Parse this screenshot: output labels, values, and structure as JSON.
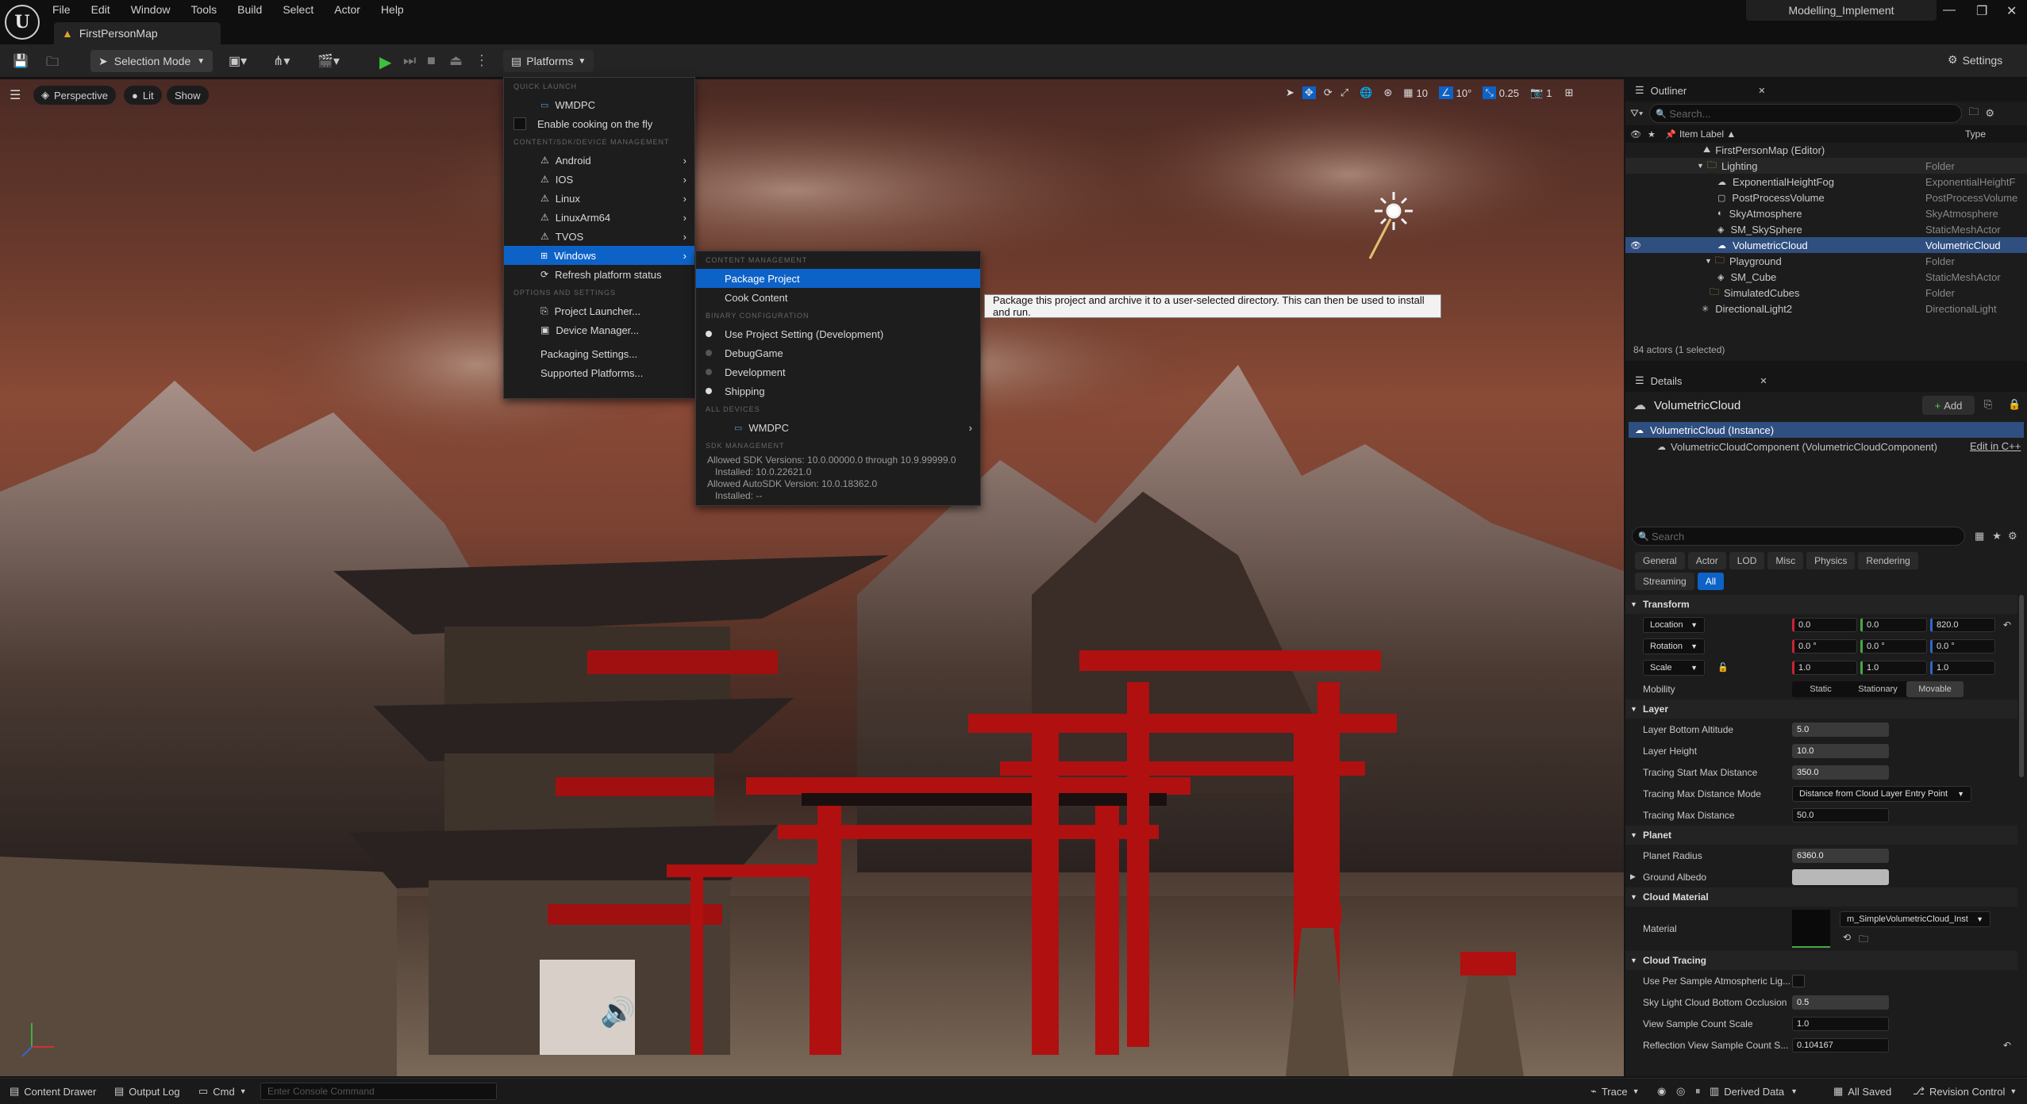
{
  "titlebar": {
    "logo": "U",
    "menu": [
      "File",
      "Edit",
      "Window",
      "Tools",
      "Build",
      "Select",
      "Actor",
      "Help"
    ],
    "map_tab": "FirstPersonMap",
    "project_name": "Modelling_Implement",
    "window_controls": [
      "minimize-icon",
      "restore-icon",
      "close-icon"
    ]
  },
  "toolbar": {
    "selection_mode": "Selection Mode",
    "platforms": "Platforms",
    "settings": "Settings"
  },
  "viewport": {
    "perspective": "Perspective",
    "lit": "Lit",
    "show": "Show",
    "grid_value": "10",
    "rotation_value": "10°",
    "scale_value": "0.25",
    "camera_speed": "1"
  },
  "platforms_menu": {
    "quick_launch_header": "QUICK LAUNCH",
    "wmdpc": "WMDPC",
    "enable_cooking": "Enable cooking on the fly",
    "content_header": "CONTENT/SDK/DEVICE MANAGEMENT",
    "platforms": [
      "Android",
      "IOS",
      "Linux",
      "LinuxArm64",
      "TVOS",
      "Windows"
    ],
    "refresh": "Refresh platform status",
    "options_header": "OPTIONS AND SETTINGS",
    "project_launcher": "Project Launcher...",
    "device_manager": "Device Manager...",
    "packaging_settings": "Packaging Settings...",
    "supported_platforms": "Supported Platforms..."
  },
  "windows_submenu": {
    "content_header": "CONTENT MANAGEMENT",
    "package_project": "Package Project",
    "cook_content": "Cook Content",
    "binary_header": "BINARY CONFIGURATION",
    "configs": [
      "Use Project Setting (Development)",
      "DebugGame",
      "Development",
      "Shipping"
    ],
    "all_devices_header": "ALL DEVICES",
    "device": "WMDPC",
    "sdk_header": "SDK MANAGEMENT",
    "sdk_line1": "Allowed SDK Versions: 10.0.00000.0 through 10.9.99999.0",
    "sdk_line2": "Installed: 10.0.22621.0",
    "sdk_line3": "Allowed AutoSDK Version: 10.0.18362.0",
    "sdk_line4": "Installed: --"
  },
  "tooltip": "Package this project and archive it to a user-selected directory. This can then be used to install and run.",
  "outliner": {
    "title": "Outliner",
    "search_placeholder": "Search...",
    "col_label": "Item Label ▲",
    "col_type": "Type",
    "rows": [
      {
        "label": "FirstPersonMap (Editor)",
        "type": ""
      },
      {
        "label": "Lighting",
        "type": "Folder"
      },
      {
        "label": "ExponentialHeightFog",
        "type": "ExponentialHeightF"
      },
      {
        "label": "PostProcessVolume",
        "type": "PostProcessVolume"
      },
      {
        "label": "SkyAtmosphere",
        "type": "SkyAtmosphere"
      },
      {
        "label": "SM_SkySphere",
        "type": "StaticMeshActor"
      },
      {
        "label": "VolumetricCloud",
        "type": "VolumetricCloud"
      },
      {
        "label": "Playground",
        "type": "Folder"
      },
      {
        "label": "SM_Cube",
        "type": "StaticMeshActor"
      },
      {
        "label": "SimulatedCubes",
        "type": "Folder"
      },
      {
        "label": "DirectionalLight2",
        "type": "DirectionalLight"
      }
    ],
    "footer": "84 actors (1 selected)"
  },
  "details": {
    "title": "Details",
    "actor_name": "VolumetricCloud",
    "add_label": "Add",
    "instance": "VolumetricCloud (Instance)",
    "component": "VolumetricCloudComponent (VolumetricCloudComponent)",
    "edit_cpp": "Edit in C++",
    "search_placeholder": "Search",
    "categories": [
      "General",
      "Actor",
      "LOD",
      "Misc",
      "Physics",
      "Rendering",
      "Streaming",
      "All"
    ],
    "transform": {
      "header": "Transform",
      "location_label": "Location",
      "location": [
        "0.0",
        "0.0",
        "820.0"
      ],
      "rotation_label": "Rotation",
      "rotation": [
        "0.0 °",
        "0.0 °",
        "0.0 °"
      ],
      "scale_label": "Scale",
      "scale": [
        "1.0",
        "1.0",
        "1.0"
      ],
      "mobility_label": "Mobility",
      "mobility": [
        "Static",
        "Stationary",
        "Movable"
      ]
    },
    "layer": {
      "header": "Layer",
      "bottom_altitude_label": "Layer Bottom Altitude",
      "bottom_altitude": "5.0",
      "height_label": "Layer Height",
      "height": "10.0",
      "tracing_start_label": "Tracing Start Max Distance",
      "tracing_start": "350.0",
      "tracing_mode_label": "Tracing Max Distance Mode",
      "tracing_mode": "Distance from Cloud Layer Entry Point",
      "tracing_max_label": "Tracing Max Distance",
      "tracing_max": "50.0"
    },
    "planet": {
      "header": "Planet",
      "radius_label": "Planet Radius",
      "radius": "6360.0",
      "albedo_label": "Ground Albedo"
    },
    "cloud_material": {
      "header": "Cloud Material",
      "material_label": "Material",
      "material": "m_SimpleVolumetricCloud_Inst"
    },
    "cloud_tracing": {
      "header": "Cloud Tracing",
      "per_sample_label": "Use Per Sample Atmospheric Lig...",
      "sky_occlusion_label": "Sky Light Cloud Bottom Occlusion",
      "sky_occlusion": "0.5",
      "view_sample_label": "View Sample Count Scale",
      "view_sample": "1.0",
      "reflection_label": "Reflection View Sample Count S...",
      "reflection": "0.104167"
    }
  },
  "statusbar": {
    "content_drawer": "Content Drawer",
    "output_log": "Output Log",
    "cmd": "Cmd",
    "console_placeholder": "Enter Console Command",
    "trace": "Trace",
    "derived_data": "Derived Data",
    "all_saved": "All Saved",
    "revision_control": "Revision Control"
  },
  "colors": {
    "highlight": "#0d62c8",
    "selection": "#2f4f80",
    "play": "#3fbf3f",
    "torii": "#b01010"
  }
}
